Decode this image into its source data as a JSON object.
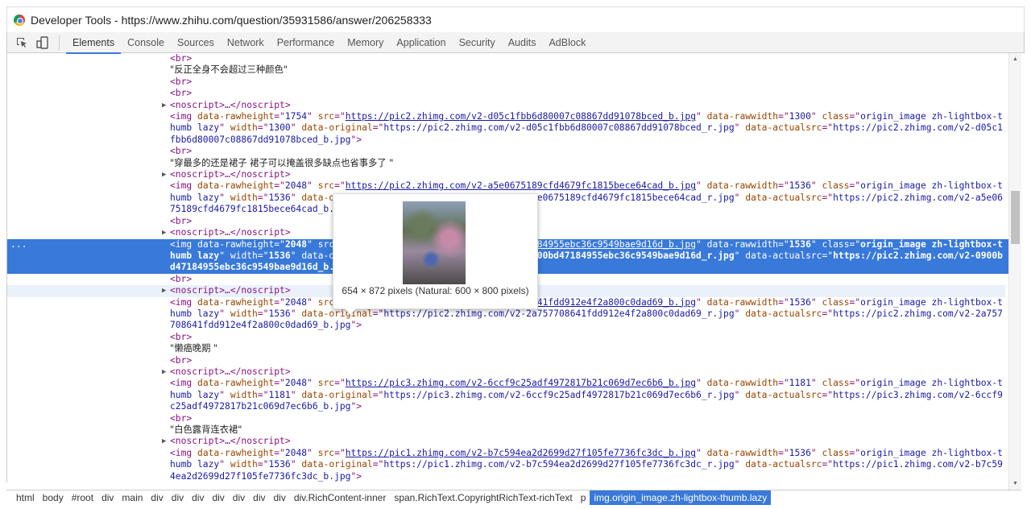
{
  "window": {
    "title": "Developer Tools - https://www.zhihu.com/question/35931586/answer/206258333"
  },
  "toolbar": {
    "icons": [
      "inspect-element-icon",
      "device-toolbar-icon"
    ],
    "tabs": [
      {
        "label": "Elements",
        "active": true
      },
      {
        "label": "Console"
      },
      {
        "label": "Sources"
      },
      {
        "label": "Network"
      },
      {
        "label": "Performance"
      },
      {
        "label": "Memory"
      },
      {
        "label": "Application"
      },
      {
        "label": "Security"
      },
      {
        "label": "Audits"
      },
      {
        "label": "AdBlock"
      }
    ]
  },
  "tree": {
    "noscript_label": "<noscript>…</noscript>",
    "br_label": "<br>",
    "selected_marker": "...",
    "selected_index": 14,
    "hovered_index": 16,
    "nodes": [
      {
        "kind": "br"
      },
      {
        "kind": "text",
        "text": "\"反正全身不会超过三种颜色\""
      },
      {
        "kind": "br"
      },
      {
        "kind": "br"
      },
      {
        "kind": "noscript"
      },
      {
        "kind": "img",
        "rawheight": "1754",
        "src": "https://pic2.zhimg.com/v2-d05c1fbb6d80007c08867dd91078bced_b.jpg",
        "rawwidth": "1300",
        "class": "origin_image zh-lightbox-thumb lazy",
        "width": "1300",
        "original": "https://pic2.zhimg.com/v2-d05c1fbb6d80007c08867dd91078bced_r.jpg",
        "actualsrc": "https://pic2.zhimg.com/v2-d05c1fbb6d80007c08867dd91078bced_b.jpg"
      },
      {
        "kind": "br"
      },
      {
        "kind": "text",
        "text": "\"穿最多的还是裙子 裙子可以掩盖很多缺点也省事多了 \""
      },
      {
        "kind": "noscript"
      },
      {
        "kind": "img",
        "rawheight": "2048",
        "src": "https://pic2.zhimg.com/v2-a5e0675189cfd4679fc1815bece64cad_b.jpg",
        "rawwidth": "1536",
        "class": "origin_image zh-lightbox-thumb lazy",
        "width": "1536",
        "original": "https://pic2.zhimg.com/v2-a5e0675189cfd4679fc1815bece64cad_r.jpg",
        "actualsrc": "https://pic2.zhimg.com/v2-a5e0675189cfd4679fc1815bece64cad_b.jpg"
      },
      {
        "kind": "br"
      },
      {
        "kind": "noscript"
      },
      {
        "kind": "spacer"
      },
      {
        "kind": "spacer"
      },
      {
        "kind": "img",
        "rawheight": "2048",
        "src": "https://pic2.zhimg.com/v2-0900bd47184955ebc36c9549bae9d16d_b.jpg",
        "rawwidth": "1536",
        "class": "origin_image zh-lightbox-thumb lazy",
        "width": "1536",
        "original": "https://pic2.zhimg.com/v2-0900bd47184955ebc36c9549bae9d16d_r.jpg",
        "actualsrc": "https://pic2.zhimg.com/v2-0900bd47184955ebc36c9549bae9d16d_b.jpg"
      },
      {
        "kind": "br"
      },
      {
        "kind": "noscript"
      },
      {
        "kind": "img",
        "rawheight": "2048",
        "src": "https://pic2.zhimg.com/v2-2a757708641fdd912e4f2a800c0dad69_b.jpg",
        "rawwidth": "1536",
        "class": "origin_image zh-lightbox-thumb lazy",
        "width": "1536",
        "original": "https://pic2.zhimg.com/v2-2a757708641fdd912e4f2a800c0dad69_r.jpg",
        "actualsrc": "https://pic2.zhimg.com/v2-2a757708641fdd912e4f2a800c0dad69_b.jpg"
      },
      {
        "kind": "br"
      },
      {
        "kind": "text",
        "text": "\"懒癌晚期 \""
      },
      {
        "kind": "br"
      },
      {
        "kind": "noscript"
      },
      {
        "kind": "img",
        "rawheight": "2048",
        "src": "https://pic3.zhimg.com/v2-6ccf9c25adf4972817b21c069d7ec6b6_b.jpg",
        "rawwidth": "1181",
        "class": "origin_image zh-lightbox-thumb lazy",
        "width": "1181",
        "original": "https://pic3.zhimg.com/v2-6ccf9c25adf4972817b21c069d7ec6b6_r.jpg",
        "actualsrc": "https://pic3.zhimg.com/v2-6ccf9c25adf4972817b21c069d7ec6b6_b.jpg"
      },
      {
        "kind": "br"
      },
      {
        "kind": "text",
        "text": "\"白色露背连衣裙\""
      },
      {
        "kind": "noscript"
      },
      {
        "kind": "img",
        "rawheight": "2048",
        "src": "https://pic1.zhimg.com/v2-b7c594ea2d2699d27f105fe7736fc3dc_b.jpg",
        "rawwidth": "1536",
        "class": "origin_image zh-lightbox-thumb lazy",
        "width": "1536",
        "original": "https://pic1.zhimg.com/v2-b7c594ea2d2699d27f105fe7736fc3dc_r.jpg",
        "actualsrc": "https://pic1.zhimg.com/v2-b7c594ea2d2699d27f105fe7736fc3dc_b.jpg"
      }
    ]
  },
  "tooltip": {
    "caption": "654 × 872 pixels (Natural: 600 × 800 pixels)"
  },
  "breadcrumbs": {
    "items": [
      "html",
      "body",
      "#root",
      "div",
      "main",
      "div",
      "div",
      "div",
      "div",
      "div",
      "div",
      "div",
      "div.RichContent-inner",
      "span.RichText.CopyrightRichText-richText",
      "p",
      "img.origin_image.zh-lightbox-thumb.lazy"
    ],
    "selected_index": 15
  },
  "colors": {
    "selection": "#3879d9",
    "tag": "#881280",
    "attr_name": "#994500",
    "attr_value": "#1a1aa6"
  }
}
